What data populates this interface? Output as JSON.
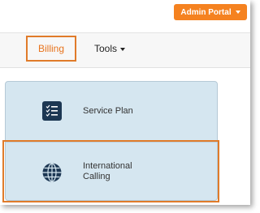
{
  "colors": {
    "accent_orange": "#f58220",
    "highlight_orange": "#e07b2a",
    "icon_navy": "#1c3753",
    "panel_blue": "#d5e6f0",
    "nav_active_text": "#e8731c"
  },
  "header": {
    "admin_portal": {
      "label": "Admin Portal",
      "icon": "caret-down-icon"
    }
  },
  "nav": {
    "billing": {
      "label": "Billing",
      "active": true
    },
    "tools": {
      "label": "Tools",
      "icon": "caret-down-icon"
    }
  },
  "billing_menu": {
    "items": [
      {
        "label": "Service Plan",
        "icon": "checklist-icon"
      },
      {
        "label": "International\nCalling",
        "icon": "globe-icon",
        "highlighted": true
      }
    ]
  }
}
